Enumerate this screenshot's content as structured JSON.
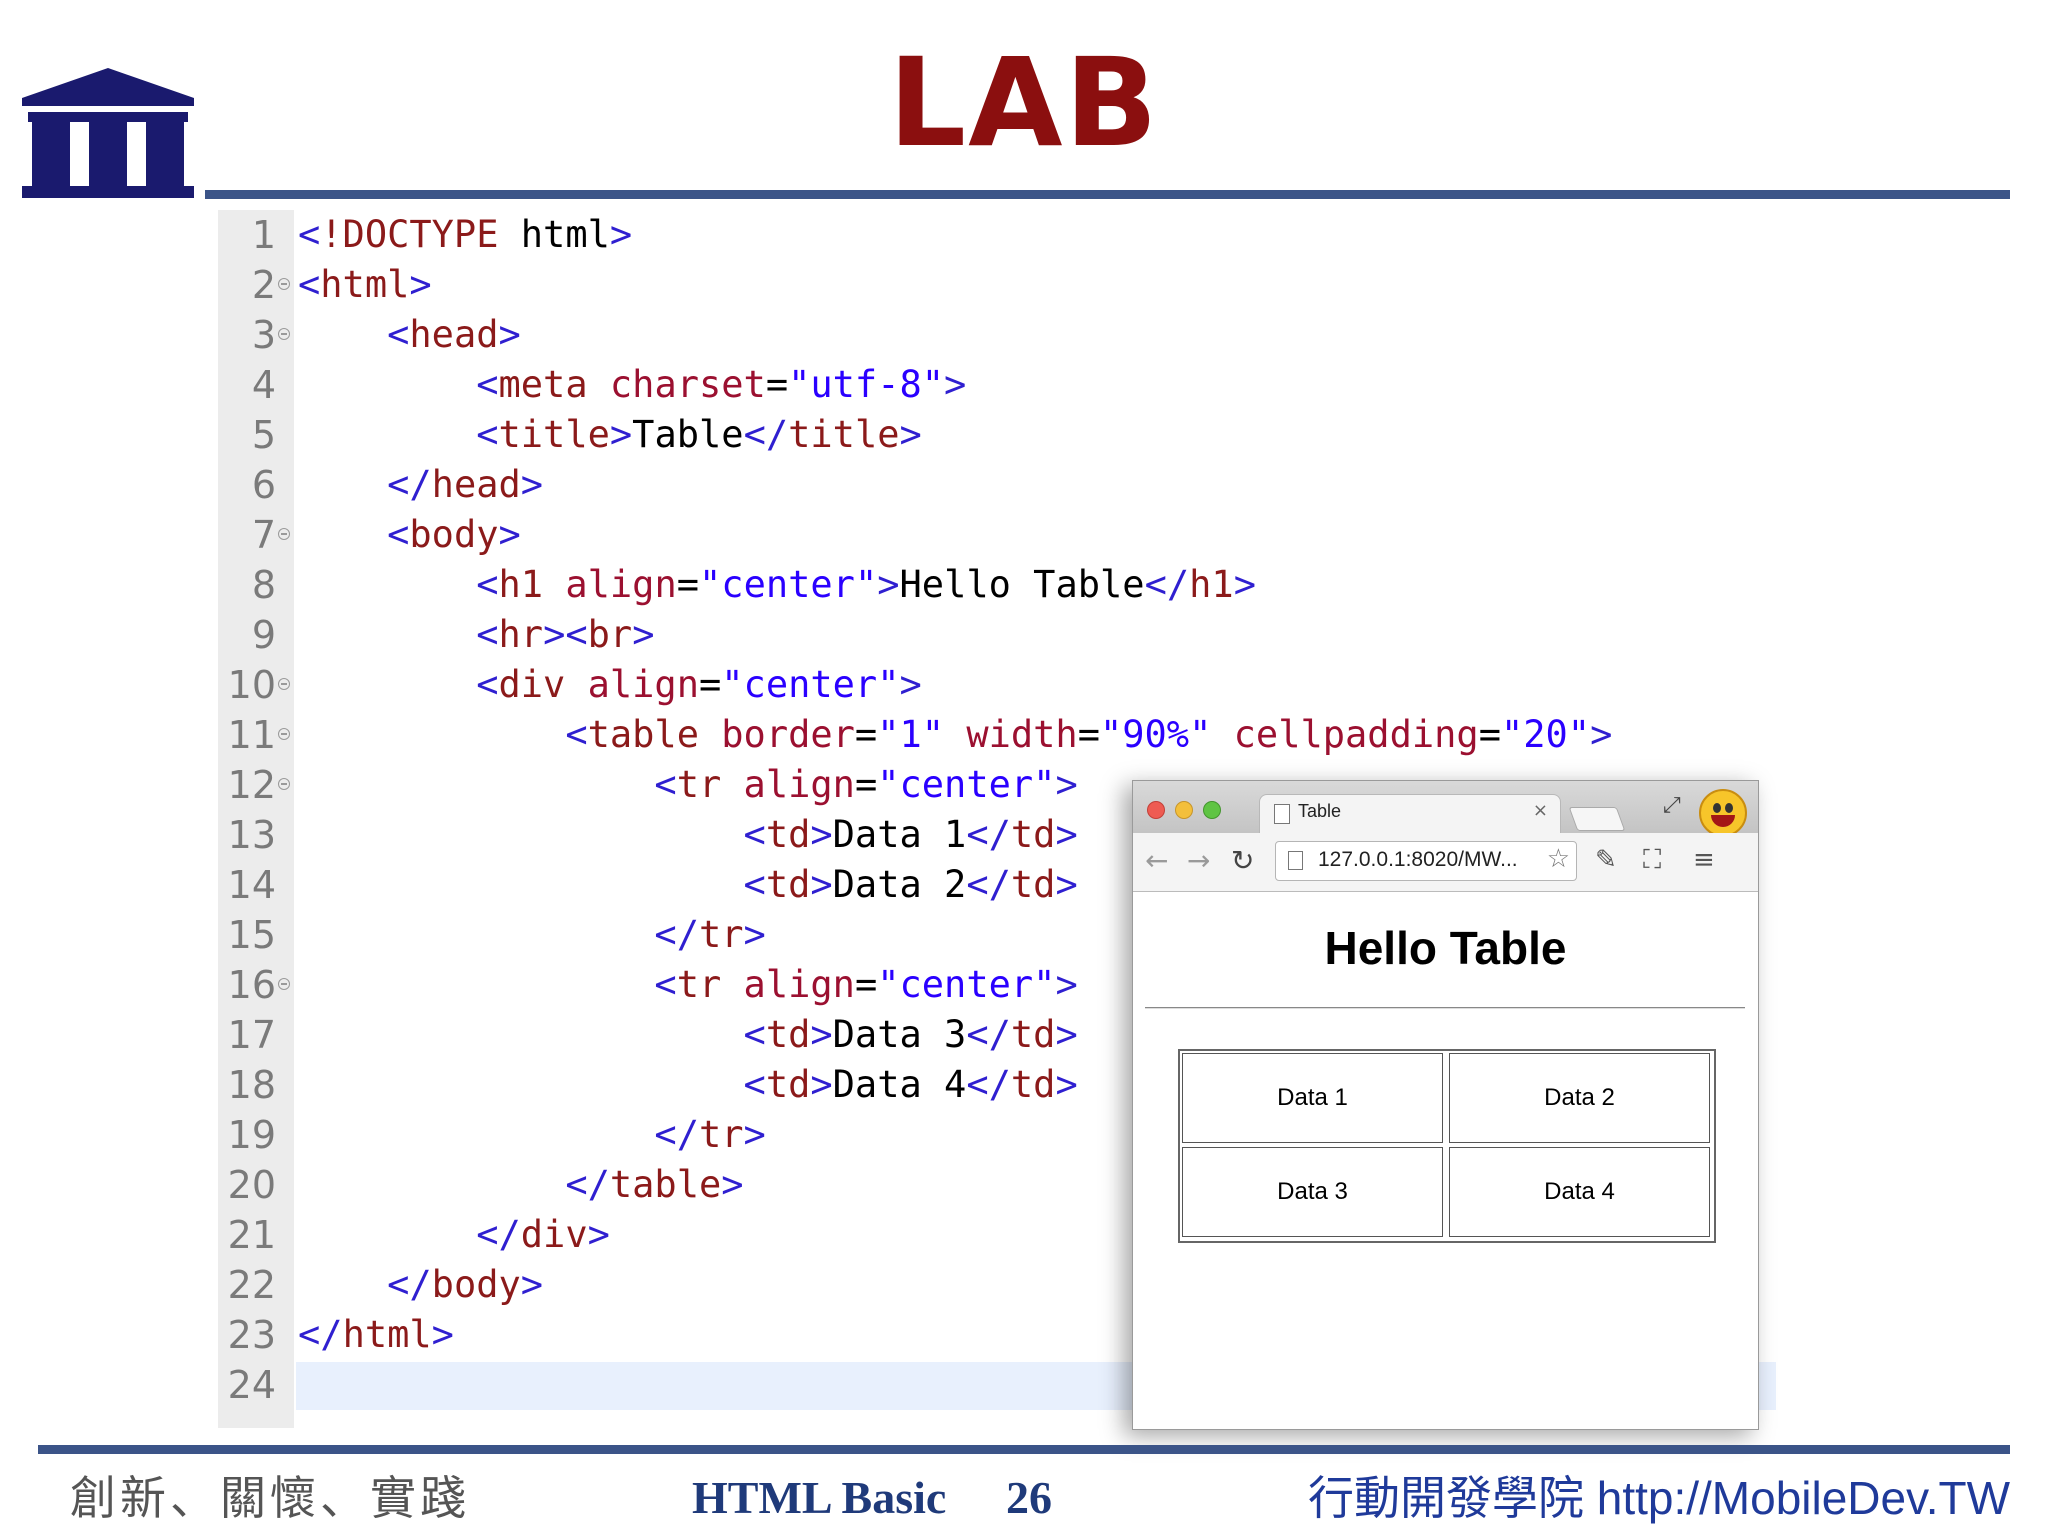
{
  "slide": {
    "title": "LAB"
  },
  "editor": {
    "lines": [
      {
        "num": "1",
        "fold": false
      },
      {
        "num": "2",
        "fold": true
      },
      {
        "num": "3",
        "fold": true
      },
      {
        "num": "4",
        "fold": false
      },
      {
        "num": "5",
        "fold": false
      },
      {
        "num": "6",
        "fold": false
      },
      {
        "num": "7",
        "fold": true
      },
      {
        "num": "8",
        "fold": false
      },
      {
        "num": "9",
        "fold": false
      },
      {
        "num": "10",
        "fold": true
      },
      {
        "num": "11",
        "fold": true
      },
      {
        "num": "12",
        "fold": true
      },
      {
        "num": "13",
        "fold": false
      },
      {
        "num": "14",
        "fold": false
      },
      {
        "num": "15",
        "fold": false
      },
      {
        "num": "16",
        "fold": true
      },
      {
        "num": "17",
        "fold": false
      },
      {
        "num": "18",
        "fold": false
      },
      {
        "num": "19",
        "fold": false
      },
      {
        "num": "20",
        "fold": false
      },
      {
        "num": "21",
        "fold": false
      },
      {
        "num": "22",
        "fold": false
      },
      {
        "num": "23",
        "fold": false
      },
      {
        "num": "24",
        "fold": false,
        "current": true
      }
    ],
    "code": [
      "<!DOCTYPE html>",
      "<html>",
      "    <head>",
      "        <meta charset=\"utf-8\">",
      "        <title>Table</title>",
      "    </head>",
      "    <body>",
      "        <h1 align=\"center\">Hello Table</h1>",
      "        <hr><br>",
      "        <div align=\"center\">",
      "            <table border=\"1\" width=\"90%\" cellpadding=\"20\">",
      "                <tr align=\"center\">",
      "                    <td>Data 1</td>",
      "                    <td>Data 2</td>",
      "                </tr>",
      "                <tr align=\"center\">",
      "                    <td>Data 3</td>",
      "                    <td>Data 4</td>",
      "                </tr>",
      "            </table>",
      "        </div>",
      "    </body>",
      "</html>",
      ""
    ],
    "colors": {
      "tag": "#8b1a1a",
      "bracket": "#2f1fd0",
      "attr": "#9b1030",
      "value": "#2a00ff",
      "text": "#000000"
    }
  },
  "browser": {
    "tab_title": "Table",
    "tab_close": "×",
    "url": "127.0.0.1:8020/MW...",
    "page_heading": "Hello Table",
    "table_cells": [
      [
        "Data 1",
        "Data 2"
      ],
      [
        "Data 3",
        "Data 4"
      ]
    ],
    "icons": [
      "back-arrow-icon",
      "forward-arrow-icon",
      "reload-icon",
      "star-icon",
      "edit-icon",
      "fullscreen-icon",
      "menu-icon"
    ]
  },
  "footer": {
    "left": "創新、關懷、實踐",
    "center": "HTML Basic",
    "page_number": "26",
    "right": "行動開發學院 http://MobileDev.TW"
  },
  "colors": {
    "title_red": "#8b0f0f",
    "rule_blue": "#3b5488",
    "logo_navy": "#1a1a6e",
    "footer_blue": "#1f3a7a"
  }
}
